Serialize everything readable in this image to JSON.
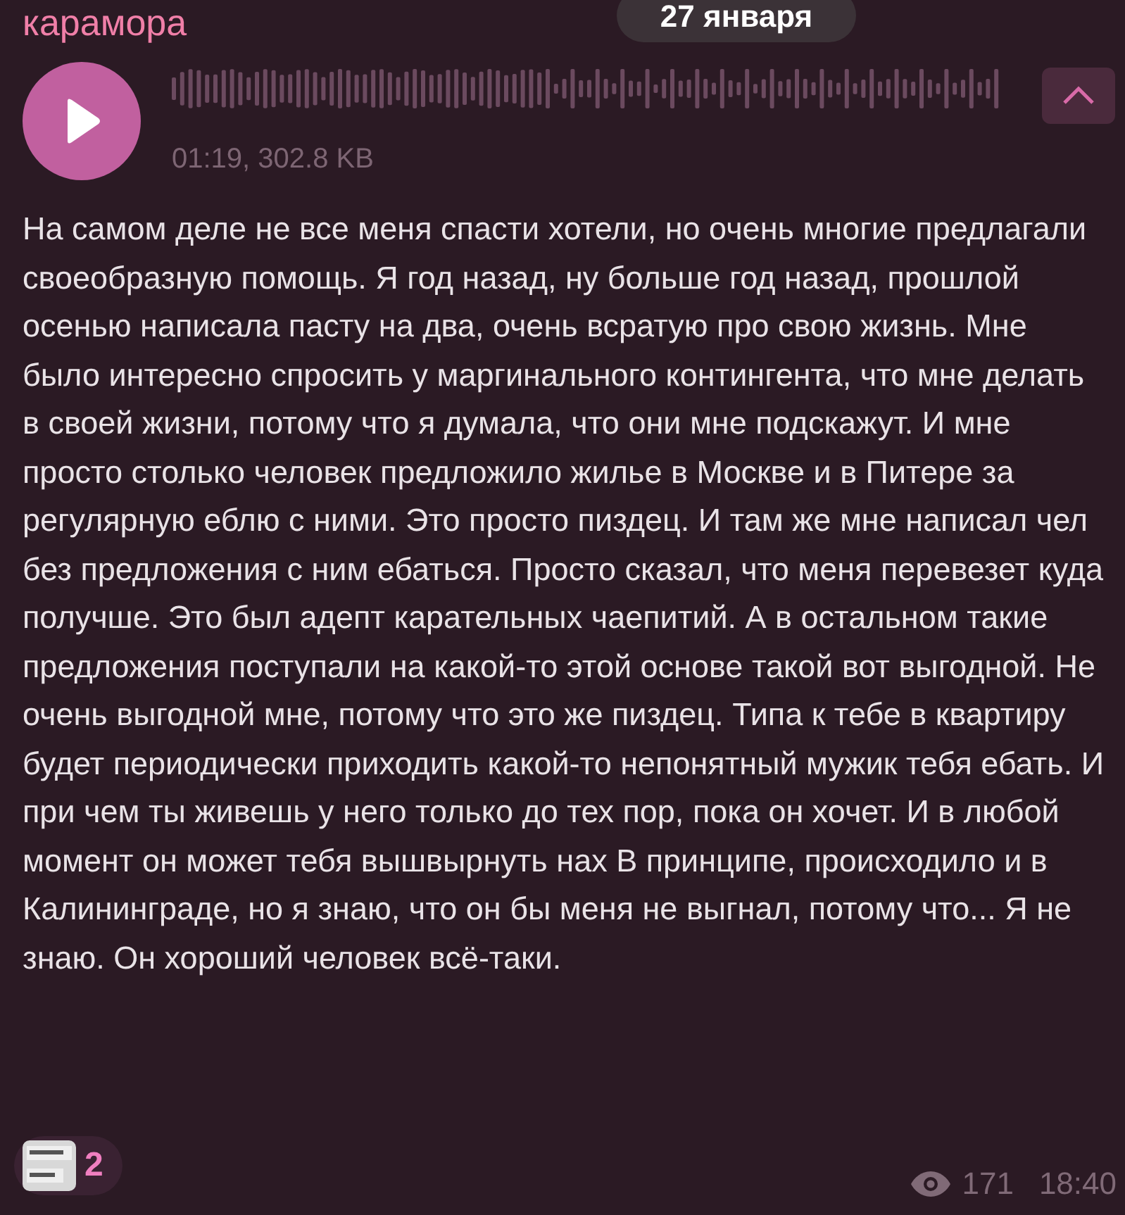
{
  "sender": "карамора",
  "date_badge": "27 января",
  "voice_message": {
    "meta": "01:19, 302.8 KB",
    "playing": false
  },
  "collapse_button": {
    "expanded": true
  },
  "text": "На самом деле не все меня спасти хотели, но очень многие предлагали своеобразную помощь. Я год назад, ну больше год назад, прошлой осенью написала пасту на два, очень всратую про свою жизнь. Мне было интересно спросить у маргинального контингента, что мне делать в своей жизни, потому что я думала, что они мне подскажут. И мне просто столько человек предложило жилье в Москве и в Питере за регулярную еблю с ними. Это просто пиздец. И там же мне написал чел без предложения с ним ебаться. Просто сказал, что меня перевезет куда получше. Это был адепт карательных чаепитий. А в остальном такие предложения поступали на какой-то этой основе такой вот выгодной. Не очень выгодной мне, потому что это же пиздец. Типа к тебе в квартиру будет периодически приходить какой-то непонятный мужик тебя ебать. И при чем ты живешь у него только до тех пор, пока он хочет. И в любой момент он может тебя вышвырнуть нах В принципе, происходило и в Калининграде, но я знаю, что он бы меня не выгнал, потому что... Я не знаю. Он хороший человек всё-таки.",
  "reaction": {
    "kind": "picture",
    "count": "2"
  },
  "views": "171",
  "time": "18:40"
}
